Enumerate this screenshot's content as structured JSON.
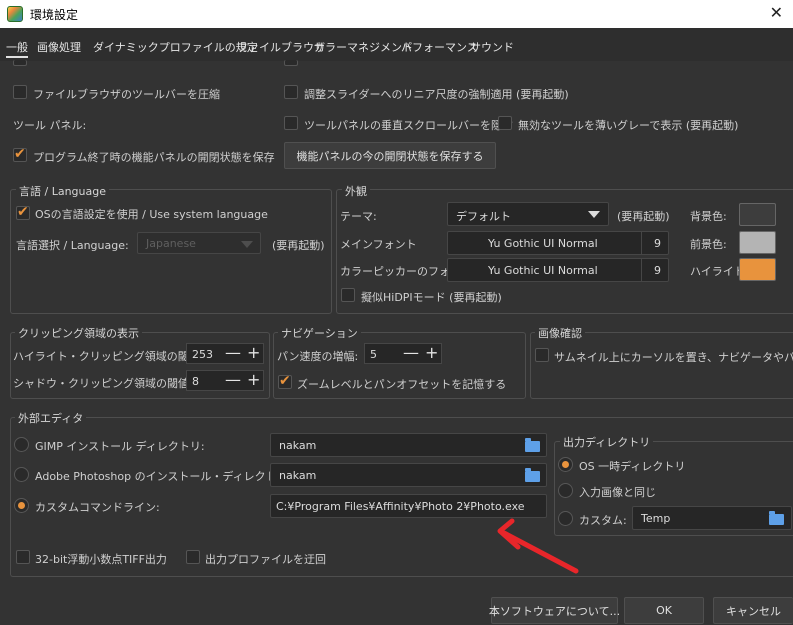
{
  "window": {
    "title": "環境設定",
    "close": "✕"
  },
  "tabs": [
    "一般",
    "画像処理",
    "ダイナミックプロファイルの規定",
    "ファイルブラウザ",
    "カラーマネジメント",
    "パフォーマンス",
    "サウンド"
  ],
  "top": {
    "compress_toolbar": "ファイルブラウザのツールバーを圧縮",
    "linear_slider": "調整スライダーへのリニア尺度の強制適用 (要再起動)",
    "tool_panel_label": "ツール パネル:",
    "tool_panel_vscroll": "ツールパネルの垂直スクロールバーを隠す",
    "gray_out_tools": "無効なツールを薄いグレーで表示 (要再起動)",
    "save_panel_state": "プログラム終了時の機能パネルの開閉状態を保存",
    "save_now_button": "機能パネルの今の開閉状態を保存する"
  },
  "language": {
    "title": "言語 / Language",
    "use_os": "OSの言語設定を使用 / Use system language",
    "select_label": "言語選択 / Language:",
    "select_value": "Japanese",
    "restart_note": "(要再起動)"
  },
  "appearance": {
    "title": "外観",
    "theme_label": "テーマ:",
    "theme_value": "デフォルト",
    "theme_note": "(要再起動)",
    "main_font_label": "メインフォント",
    "main_font_value": "Yu Gothic UI Normal",
    "main_font_size": "9",
    "picker_font_label": "カラーピッカーのフォント:",
    "picker_font_value": "Yu Gothic UI Normal",
    "picker_font_size": "9",
    "hidpi": "擬似HiDPIモード (要再起動)",
    "bg_label": "背景色:",
    "fg_label": "前景色:",
    "hl_label": "ハイライト:",
    "bg_color": "#3d3d3d",
    "fg_color": "#b4b4b4",
    "hl_color": "#e8933d"
  },
  "clipping": {
    "title": "クリッピング領域の表示",
    "highlight_label": "ハイライト・クリッピング領域の閾値:",
    "highlight_value": "253",
    "shadow_label": "シャドウ・クリッピング領域の閾値:",
    "shadow_value": "8",
    "minus": "—",
    "plus": "+"
  },
  "navigation": {
    "title": "ナビゲーション",
    "pan_label": "パン速度の増幅:",
    "pan_value": "5",
    "remember_zoom": "ズームレベルとパンオフセットを記憶する"
  },
  "image_check": {
    "title": "画像確認",
    "thumb_cursor": "サムネイル上にカーソルを置き、ナビゲータやパンを行"
  },
  "external_editor": {
    "title": "外部エディタ",
    "gimp_label": "GIMP インストール ディレクトリ:",
    "gimp_value": "nakam",
    "ps_label": "Adobe Photoshop のインストール・ディレクトリ:",
    "ps_value": "nakam",
    "custom_label": "カスタムコマンドライン:",
    "custom_value": "C:¥Program Files¥Affinity¥Photo 2¥Photo.exe",
    "tiff32": "32-bit浮動小数点TIFF出力",
    "bypass_profile": "出力プロファイルを迂回",
    "output_dir": {
      "title": "出力ディレクトリ",
      "os_temp": "OS 一時ディレクトリ",
      "same_as_input": "入力画像と同じ",
      "custom_label": "カスタム:",
      "custom_value": "Temp"
    }
  },
  "footer": {
    "about": "本ソフトウェアについて...",
    "ok": "OK",
    "cancel": "キャンセル"
  },
  "annotation": {
    "arrow_color": "#e8262a"
  }
}
